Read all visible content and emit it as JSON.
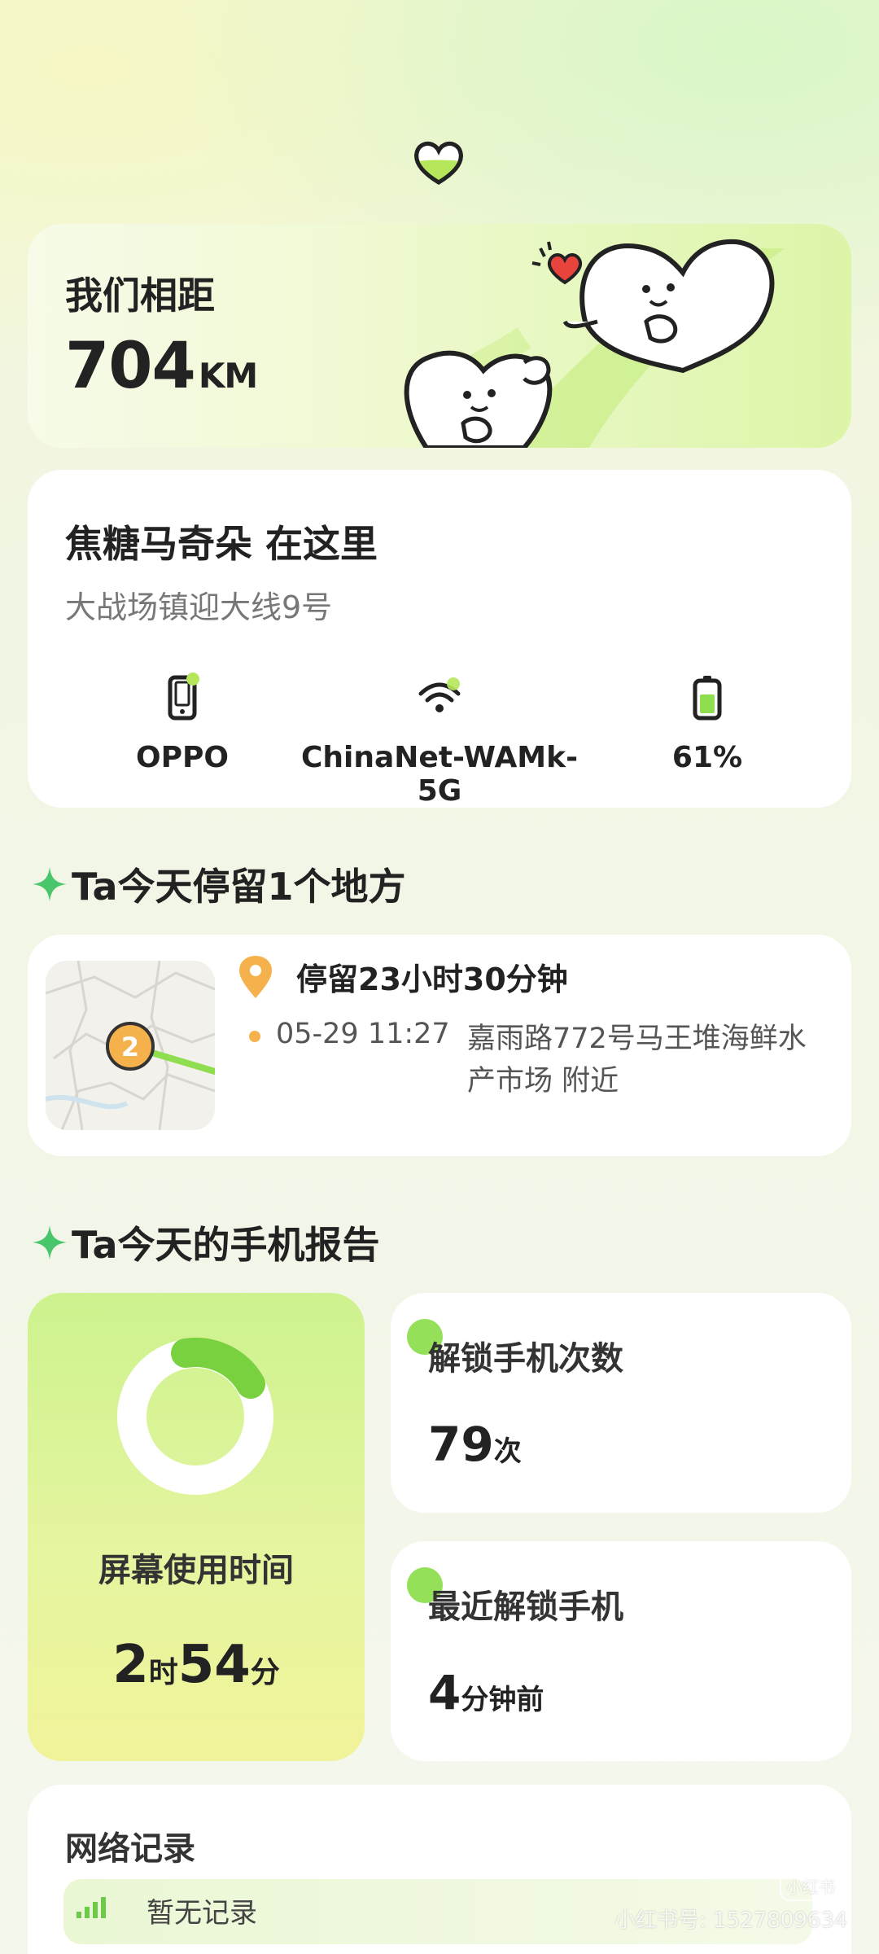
{
  "distance": {
    "title": "我们相距",
    "value": "704",
    "unit": "KM"
  },
  "location": {
    "title": "焦糖马奇朵 在这里",
    "address": "大战场镇迎大线9号",
    "devices": [
      {
        "icon": "phone-icon",
        "label": "OPPO"
      },
      {
        "icon": "wifi-icon",
        "label": "ChinaNet-WAMk-5G"
      },
      {
        "icon": "battery-icon",
        "label": "61%"
      }
    ],
    "battery_level": 0.61
  },
  "stay_section": {
    "title": "Ta今天停留1个地方",
    "duration": "停留23小时30分钟",
    "time": "05-29 11:27",
    "place": "嘉雨路772号马王堆海鲜水产市场 附近",
    "map_marker": "2"
  },
  "report_section": {
    "title": "Ta今天的手机报告",
    "screen_time": {
      "label": "屏幕使用时间",
      "hours": "2",
      "hours_unit": "时",
      "minutes": "54",
      "minutes_unit": "分"
    },
    "unlock_count": {
      "label": "解锁手机次数",
      "value": "79",
      "unit": "次"
    },
    "last_unlock": {
      "label": "最近解锁手机",
      "value": "4",
      "unit": "分钟前"
    }
  },
  "network": {
    "title": "网络记录",
    "empty_text": "暂无记录"
  },
  "watermark": {
    "logo": "小红书",
    "text": "小红书号: 1527809634"
  },
  "colors": {
    "accent_green": "#8ede4f",
    "pin_orange": "#f5b24c",
    "heart_red": "#e8433c"
  }
}
